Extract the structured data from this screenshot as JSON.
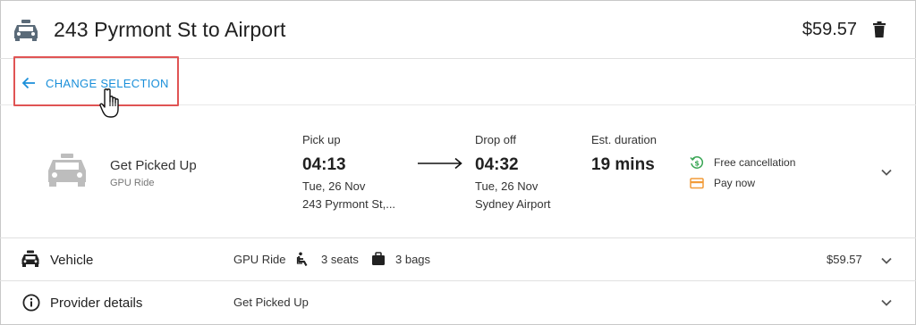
{
  "header": {
    "title": "243 Pyrmont St to Airport",
    "price": "$59.57",
    "icons": {
      "taxi": "taxi-icon",
      "delete": "trash-icon"
    }
  },
  "change_selection": {
    "label": "CHANGE SELECTION",
    "icon": "arrow-left-icon"
  },
  "trip": {
    "provider_name": "Get Picked Up",
    "provider_subtitle": "GPU Ride",
    "pickup": {
      "label": "Pick up",
      "time": "04:13",
      "date": "Tue, 26 Nov",
      "place": "243 Pyrmont St,..."
    },
    "dropoff": {
      "label": "Drop off",
      "time": "04:32",
      "date": "Tue, 26 Nov",
      "place": "Sydney Airport"
    },
    "duration": {
      "label": "Est. duration",
      "value": "19 mins"
    },
    "perks": [
      {
        "label": "Free cancellation",
        "icon": "refund-icon",
        "color": "#3aa655"
      },
      {
        "label": "Pay now",
        "icon": "credit-card-icon",
        "color": "#f29b38"
      }
    ]
  },
  "vehicle_row": {
    "title": "Vehicle",
    "ride": "GPU Ride",
    "seats": "3 seats",
    "bags": "3 bags",
    "price": "$59.57"
  },
  "provider_row": {
    "title": "Provider details",
    "value": "Get Picked Up"
  },
  "colors": {
    "accent": "#1a8fd9",
    "highlight": "#e05454",
    "icon_gray": "#5a6a78"
  }
}
